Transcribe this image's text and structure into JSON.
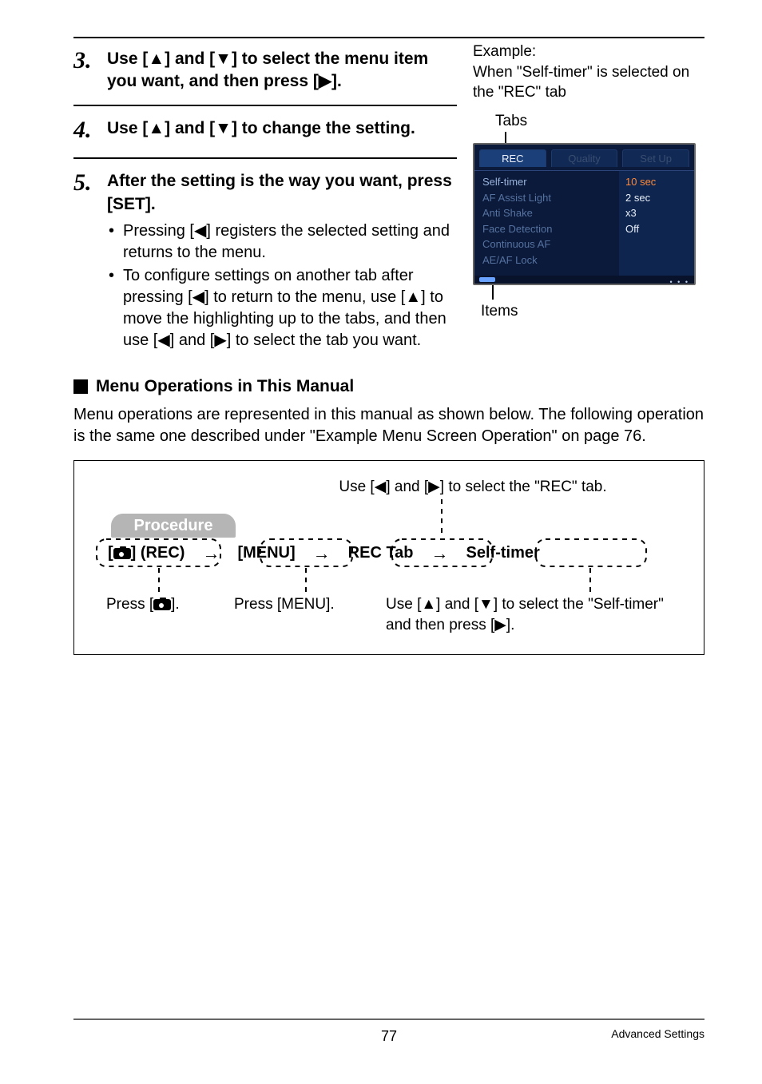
{
  "steps": {
    "s3": {
      "num": "3.",
      "title_before": "Use [",
      "up": "▲",
      "title_mid": "] and [",
      "down": "▼",
      "title_mid2": "] to select the menu item you want, and then press [",
      "right": "▶",
      "title_after": "]."
    },
    "s4": {
      "num": "4.",
      "title_before": "Use [",
      "up": "▲",
      "title_mid": "] and [",
      "down": "▼",
      "title_after": "] to change the setting."
    },
    "s5": {
      "num": "5.",
      "title": "After the setting is the way you want, press [SET].",
      "b1_before": "Pressing [",
      "b1_left": "◀",
      "b1_after": "] registers the selected setting and returns to the menu.",
      "b2a": "To configure settings on another tab after pressing [",
      "b2_left": "◀",
      "b2b": "] to return to the menu, use [",
      "b2_up": "▲",
      "b2c": "] to move the highlighting up to the tabs, and then use [",
      "b2_left2": "◀",
      "b2d": "] and [",
      "b2_right": "▶",
      "b2e": "] to select the tab you want."
    }
  },
  "right": {
    "example_line1": "Example:",
    "example_line2": "When \"Self-timer\" is selected on the \"REC\" tab",
    "tabs_label": "Tabs",
    "items_label": "Items"
  },
  "cam": {
    "tabs": [
      "REC",
      "Quality",
      "Set Up"
    ],
    "items": [
      "Self-timer",
      "AF Assist Light",
      "Anti Shake",
      "Face Detection",
      "Continuous AF",
      "AE/AF Lock"
    ],
    "values": [
      "10 sec",
      "2 sec",
      "x3",
      "Off"
    ]
  },
  "section_heading": "Menu Operations in This Manual",
  "intro": "Menu operations are represented in this manual as shown below. The following operation is the same one described under \"Example Menu Screen Operation\" on page 76.",
  "diagram": {
    "tip_top_before": "Use [",
    "tip_top_left": "◀",
    "tip_top_mid": "] and [",
    "tip_top_right": "▶",
    "tip_top_after": "] to select the \"REC\" tab.",
    "procedure_label": "Procedure",
    "flow": {
      "rec_before": "[",
      "rec_after": "] (REC)",
      "menu": "[MENU]",
      "rectab": "REC Tab",
      "selftimer": "Self-timer",
      "arrow": "→"
    },
    "tip1_before": "Press [",
    "tip1_after": "].",
    "tip2": "Press [MENU].",
    "tip3_before": "Use [",
    "tip3_up": "▲",
    "tip3_mid": "] and [",
    "tip3_down": "▼",
    "tip3_mid2": "] to select the \"Self-timer\" and then press [",
    "tip3_right": "▶",
    "tip3_after": "]."
  },
  "footer": {
    "page": "77",
    "label": "Advanced Settings"
  }
}
